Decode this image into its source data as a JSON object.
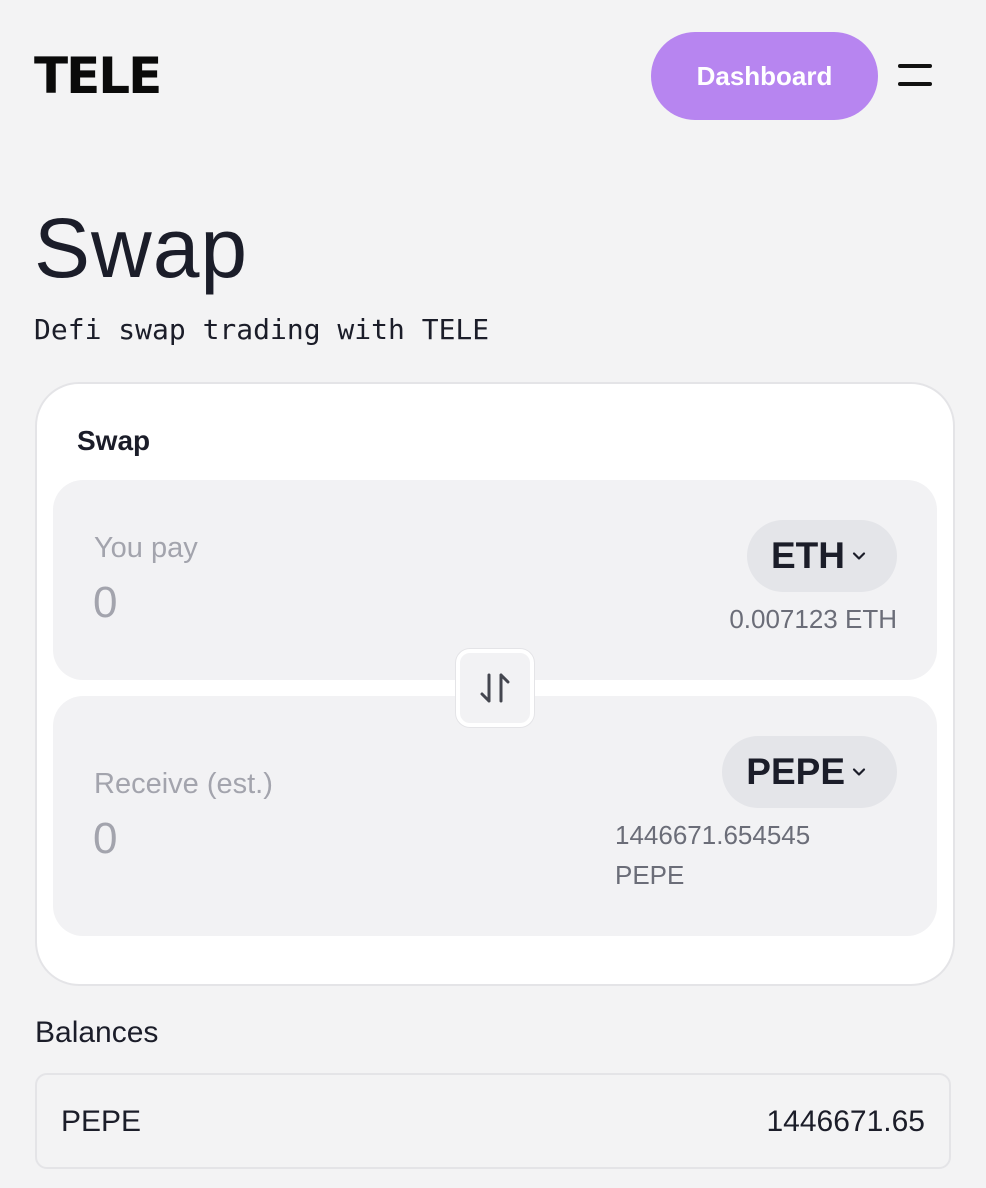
{
  "header": {
    "logo_text": "TELE",
    "dashboard_label": "Dashboard",
    "menu_icon": "hamburger-menu-icon"
  },
  "page": {
    "title": "Swap",
    "subtitle": "Defi swap trading with TELE"
  },
  "swap_card": {
    "title": "Swap",
    "pay": {
      "label": "You pay",
      "amount": "0",
      "token": "ETH",
      "balance": "0.007123 ETH"
    },
    "switch_icon": "swap-direction-icon",
    "receive": {
      "label": "Receive (est.)",
      "amount": "0",
      "token": "PEPE",
      "balance_line1": "1446671.654545",
      "balance_line2": "PEPE"
    }
  },
  "balances": {
    "title": "Balances",
    "rows": [
      {
        "token": "PEPE",
        "amount": "1446671.65"
      }
    ]
  },
  "colors": {
    "background": "#f3f3f4",
    "accent": "#b785f0",
    "card": "#ffffff",
    "panel": "#f2f2f4",
    "muted_text": "#a3a4ad",
    "text": "#1b1d29"
  }
}
